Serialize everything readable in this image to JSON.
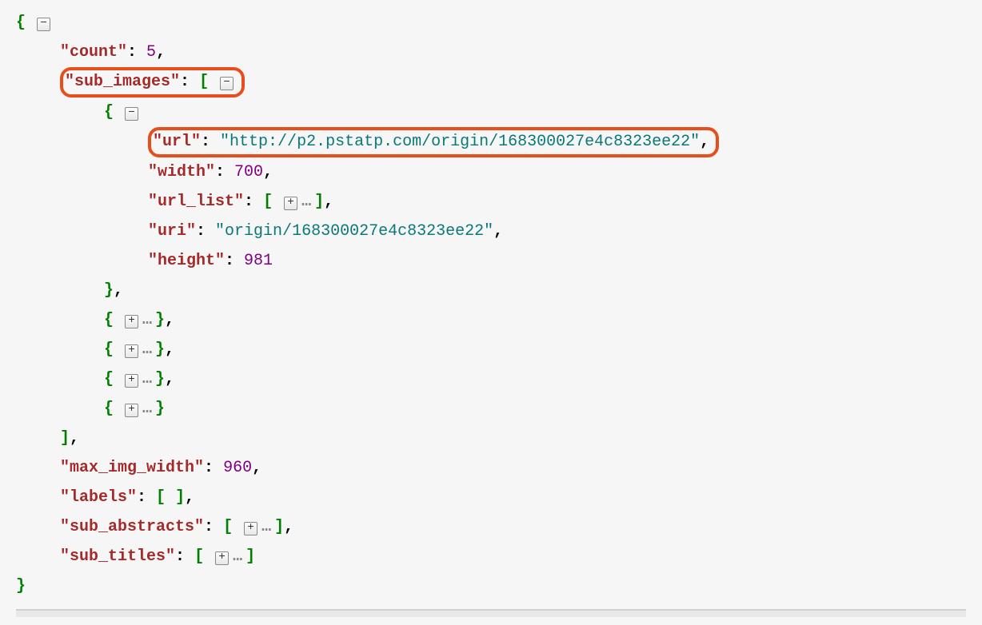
{
  "glyphs": {
    "minus": "⊟",
    "plus": "⊞",
    "ellipsis": "…"
  },
  "json": {
    "brace_open": "{",
    "brace_close": "}",
    "bracket_open": "[",
    "bracket_close": "]",
    "keys": {
      "count": "\"count\"",
      "sub_images": "\"sub_images\"",
      "url": "\"url\"",
      "width": "\"width\"",
      "url_list": "\"url_list\"",
      "uri": "\"uri\"",
      "height": "\"height\"",
      "max_img_width": "\"max_img_width\"",
      "labels": "\"labels\"",
      "sub_abstracts": "\"sub_abstracts\"",
      "sub_titles": "\"sub_titles\""
    },
    "values": {
      "count": "5",
      "url": "\"http://p2.pstatp.com/origin/168300027e4c8323ee22\"",
      "width": "700",
      "uri": "\"origin/168300027e4c8323ee22\"",
      "height": "981",
      "max_img_width": "960"
    },
    "punct": {
      "colon": ":",
      "comma": ","
    }
  }
}
